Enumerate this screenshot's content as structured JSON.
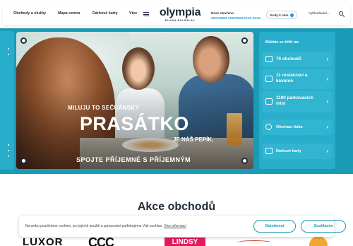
{
  "nav": {
    "items": [
      {
        "label": "Obchody a služby"
      },
      {
        "label": "Mapa centra"
      },
      {
        "label": "Dárkové karty"
      },
      {
        "label": "Více"
      }
    ]
  },
  "logo": {
    "name": "olympia",
    "city": "MLADÁ BOLESLAV"
  },
  "hours": {
    "title": "Dnes otevřeno",
    "value": "OBCHODNÍ CENTRUM 09:00–20:00"
  },
  "howto": {
    "label": "Kudy k nám",
    "icon": "location-pin-icon"
  },
  "search": {
    "label": "Vyhledávání...",
    "icon": "search-icon"
  },
  "hero": {
    "line1": "MILUJU TO SEČUÁNSKÝ",
    "big": "PRASÁTKO",
    "sub": "JE NÁŠ PEPÍK.",
    "bottom": "SPOJTE PŘÍJEMNÉ S PŘÍJEMNÝM"
  },
  "sidebar": {
    "heading": "Můžete se těšit na:",
    "items": [
      {
        "label": "70 obchodů",
        "icon": "shopping-bag-icon"
      },
      {
        "label": "11 restaurací a kaváren",
        "icon": "cutlery-icon"
      },
      {
        "label": "1100 parkovacích míst",
        "icon": "parking-icon"
      },
      {
        "label": "Otevírací doba",
        "icon": "clock-icon"
      },
      {
        "label": "Dárkové karty",
        "icon": "gift-icon"
      }
    ]
  },
  "section": {
    "title": "Akce obchodů"
  },
  "logos": {
    "luxor": "LUXOR",
    "ccc": "CCC",
    "lindsy": "LINDSY"
  },
  "cookie": {
    "text": "Na webu používáme cookies, pro jejichž použití a zpracování potřebujeme Váš souhlas.",
    "link": "Více informací",
    "deny": "Odmítnout",
    "accept": "Souhlasím"
  },
  "colors": {
    "accent": "#1b9ab5",
    "accent_light": "#28aecb",
    "text": "#1d2a3a",
    "brand_pink": "#e5195f"
  }
}
